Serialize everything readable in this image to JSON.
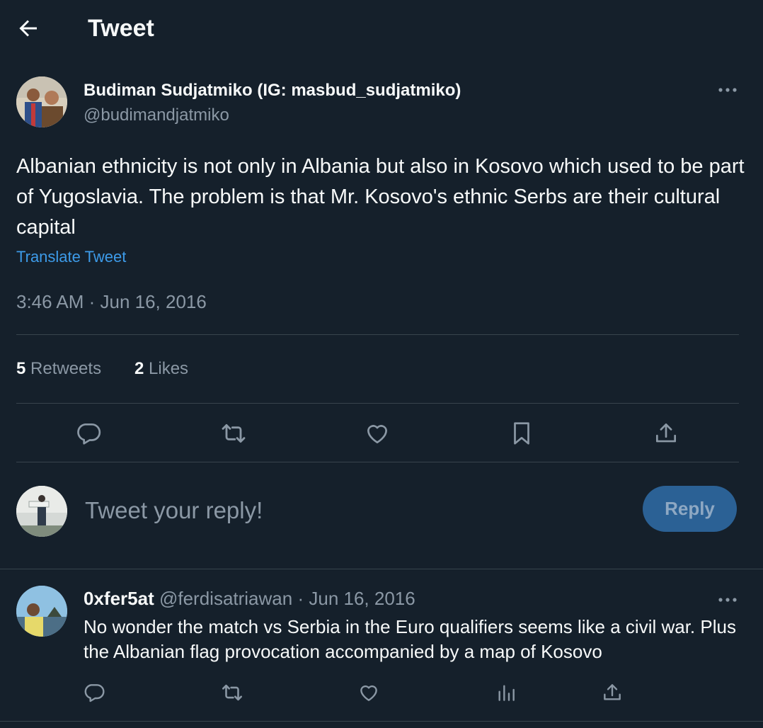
{
  "header": {
    "title": "Tweet",
    "back_icon": "arrow-left-icon"
  },
  "tweet": {
    "author_name": "Budiman Sudjatmiko (IG: masbud_sudjatmiko)",
    "author_handle": "@budimandjatmiko",
    "text": "Albanian ethnicity is not only in Albania but also in Kosovo which used to be part of Yugoslavia. The problem is that Mr. Kosovo's ethnic Serbs are their cultural capital",
    "translate_label": "Translate Tweet",
    "timestamp": "3:46 AM · Jun 16, 2016",
    "retweets_count": "5",
    "retweets_label": "Retweets",
    "likes_count": "2",
    "likes_label": "Likes"
  },
  "compose": {
    "placeholder": "Tweet your reply!",
    "reply_button_label": "Reply"
  },
  "reply": {
    "author_name": "0xfer5at",
    "author_handle": "@ferdisatriawan",
    "separator": "·",
    "date": "Jun 16, 2016",
    "text": "No wonder the match vs Serbia in the Euro qualifiers seems like a civil war. Plus the Albanian flag provocation accompanied by a map of Kosovo"
  },
  "colors": {
    "background": "#15202b",
    "text": "#f7f9f9",
    "muted": "#8b98a5",
    "link": "#3d9be9",
    "divider": "#38444d",
    "reply_button": "#2b6195"
  }
}
